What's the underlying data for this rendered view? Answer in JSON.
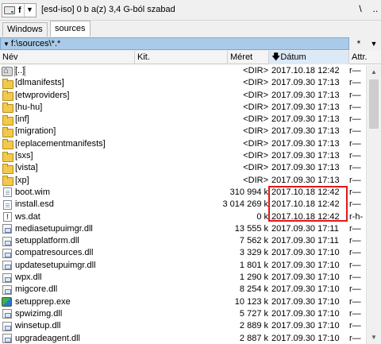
{
  "drivebar": {
    "drive_letter": "f",
    "info": "[esd-iso]  0 b a(z) 3,4 G-ból szabad",
    "root_button": "\\",
    "up_button": ".."
  },
  "tabs": [
    {
      "label": "Windows",
      "active": false
    },
    {
      "label": "sources",
      "active": true
    }
  ],
  "path": {
    "value": "f:\\sources\\*.*",
    "history_button": "*",
    "dropdown": "▼"
  },
  "columns": {
    "name": "Név",
    "ext": "Kit.",
    "size": "Méret",
    "date": "Dátum",
    "attr": "Attr."
  },
  "sort": {
    "column": "date",
    "direction": "descending"
  },
  "files": [
    {
      "name": "[..]",
      "type": "up",
      "size": "<DIR>",
      "date": "2017.10.18 12:42",
      "attr": "r—"
    },
    {
      "name": "[dlmanifests]",
      "type": "folder",
      "size": "<DIR>",
      "date": "2017.09.30 17:13",
      "attr": "r—"
    },
    {
      "name": "[etwproviders]",
      "type": "folder",
      "size": "<DIR>",
      "date": "2017.09.30 17:13",
      "attr": "r—"
    },
    {
      "name": "[hu-hu]",
      "type": "folder",
      "size": "<DIR>",
      "date": "2017.09.30 17:13",
      "attr": "r—"
    },
    {
      "name": "[inf]",
      "type": "folder",
      "size": "<DIR>",
      "date": "2017.09.30 17:13",
      "attr": "r—"
    },
    {
      "name": "[migration]",
      "type": "folder",
      "size": "<DIR>",
      "date": "2017.09.30 17:13",
      "attr": "r—"
    },
    {
      "name": "[replacementmanifests]",
      "type": "folder",
      "size": "<DIR>",
      "date": "2017.09.30 17:13",
      "attr": "r—"
    },
    {
      "name": "[sxs]",
      "type": "folder",
      "size": "<DIR>",
      "date": "2017.09.30 17:13",
      "attr": "r—"
    },
    {
      "name": "[vista]",
      "type": "folder",
      "size": "<DIR>",
      "date": "2017.09.30 17:13",
      "attr": "r—"
    },
    {
      "name": "[xp]",
      "type": "folder",
      "size": "<DIR>",
      "date": "2017.09.30 17:13",
      "attr": "r—"
    },
    {
      "name": "boot.wim",
      "type": "doc",
      "size": "310 994 k",
      "date": "2017.10.18 12:42",
      "attr": "r—"
    },
    {
      "name": "install.esd",
      "type": "doc",
      "size": "3 014 269 k",
      "date": "2017.10.18 12:42",
      "attr": "r—"
    },
    {
      "name": "ws.dat",
      "type": "dat",
      "size": "0 k",
      "date": "2017.10.18 12:42",
      "attr": "r-h-"
    },
    {
      "name": "mediasetupuimgr.dll",
      "type": "dll",
      "size": "13 555 k",
      "date": "2017.09.30 17:11",
      "attr": "r—"
    },
    {
      "name": "setupplatform.dll",
      "type": "dll",
      "size": "7 562 k",
      "date": "2017.09.30 17:11",
      "attr": "r—"
    },
    {
      "name": "compatresources.dll",
      "type": "dll",
      "size": "3 329 k",
      "date": "2017.09.30 17:10",
      "attr": "r—"
    },
    {
      "name": "updatesetupuimgr.dll",
      "type": "dll",
      "size": "1 801 k",
      "date": "2017.09.30 17:10",
      "attr": "r—"
    },
    {
      "name": "wpx.dll",
      "type": "dll",
      "size": "1 290 k",
      "date": "2017.09.30 17:10",
      "attr": "r—"
    },
    {
      "name": "migcore.dll",
      "type": "dll",
      "size": "8 254 k",
      "date": "2017.09.30 17:10",
      "attr": "r—"
    },
    {
      "name": "setupprep.exe",
      "type": "exe",
      "size": "10 123 k",
      "date": "2017.09.30 17:10",
      "attr": "r—"
    },
    {
      "name": "spwizimg.dll",
      "type": "dll",
      "size": "5 727 k",
      "date": "2017.09.30 17:10",
      "attr": "r—"
    },
    {
      "name": "winsetup.dll",
      "type": "dll",
      "size": "2 889 k",
      "date": "2017.09.30 17:10",
      "attr": "r—"
    },
    {
      "name": "upgradeagent.dll",
      "type": "dll",
      "size": "2 887 k",
      "date": "2017.09.30 17:10",
      "attr": "r—"
    }
  ],
  "colors": {
    "path_bar": "#a9cbe9",
    "highlight_box": "#e01818",
    "folder": "#f2c94c"
  }
}
